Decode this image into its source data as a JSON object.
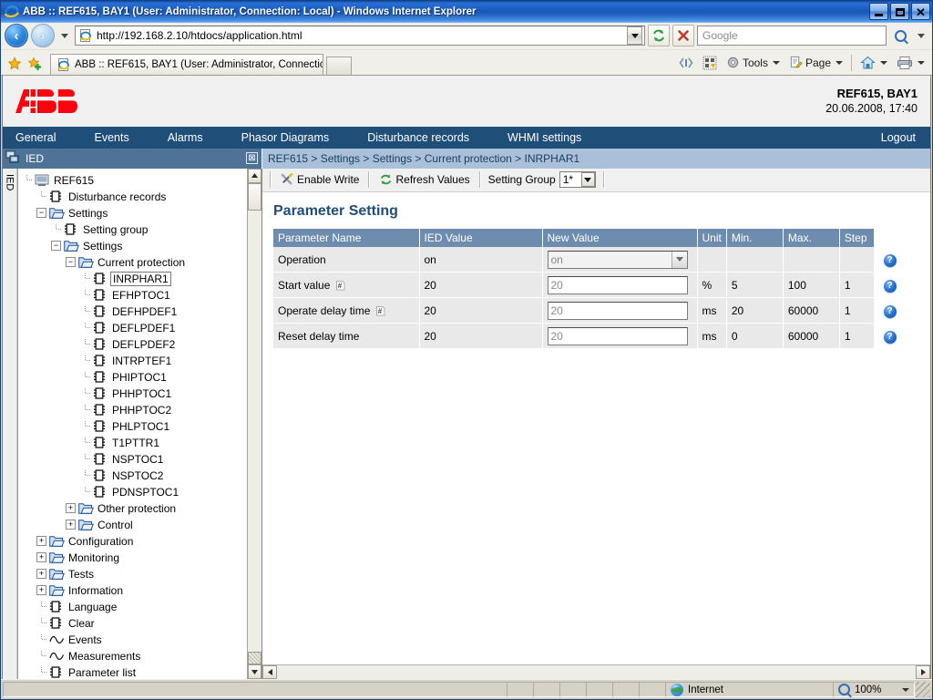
{
  "window": {
    "title": "ABB :: REF615, BAY1 (User: Administrator, Connection: Local) - Windows Internet Explorer",
    "minimize_label": "_",
    "maximize_label": "□",
    "close_label": "✕"
  },
  "browser": {
    "url": "http://192.168.2.10/htdocs/application.html",
    "search_placeholder": "Google",
    "tab_title": "ABB :: REF615, BAY1 (User: Administrator, Connectio...",
    "commands": [
      {
        "name": "tools",
        "label": "Tools",
        "has_caret": true
      },
      {
        "name": "page",
        "label": "Page",
        "has_caret": true
      }
    ]
  },
  "header": {
    "brand": "ABB",
    "device_name": "REF615, BAY1",
    "device_datetime": "20.06.2008, 17:40"
  },
  "nav": {
    "items": [
      {
        "id": "general",
        "label": "General"
      },
      {
        "id": "events",
        "label": "Events"
      },
      {
        "id": "alarms",
        "label": "Alarms"
      },
      {
        "id": "phasor-diagrams",
        "label": "Phasor Diagrams"
      },
      {
        "id": "disturbance-records",
        "label": "Disturbance records"
      },
      {
        "id": "whmi-settings",
        "label": "WHMI settings"
      }
    ],
    "logout": "Logout"
  },
  "panel": {
    "ied_label": "IED",
    "ied_tab_label": "IED",
    "close_glyph": "⊠",
    "breadcrumb": "REF615 > Settings > Settings > Current protection > INRPHAR1"
  },
  "tree": [
    {
      "label": "REF615",
      "depth": 0,
      "icon": "device-icon",
      "expander": "none",
      "selected": false
    },
    {
      "label": "Disturbance records",
      "depth": 1,
      "icon": "ied-leaf-icon",
      "expander": "none",
      "selected": false
    },
    {
      "label": "Settings",
      "depth": 1,
      "icon": "folder-icon",
      "expander": "collapse",
      "selected": false
    },
    {
      "label": "Setting group",
      "depth": 2,
      "icon": "ied-leaf-icon",
      "expander": "none",
      "selected": false
    },
    {
      "label": "Settings",
      "depth": 2,
      "icon": "folder-icon",
      "expander": "collapse",
      "selected": false
    },
    {
      "label": "Current protection",
      "depth": 3,
      "icon": "folder-icon",
      "expander": "collapse",
      "selected": false
    },
    {
      "label": "INRPHAR1",
      "depth": 4,
      "icon": "ied-leaf-icon",
      "expander": "none",
      "selected": true
    },
    {
      "label": "EFHPTOC1",
      "depth": 4,
      "icon": "ied-leaf-icon",
      "expander": "none",
      "selected": false
    },
    {
      "label": "DEFHPDEF1",
      "depth": 4,
      "icon": "ied-leaf-icon",
      "expander": "none",
      "selected": false
    },
    {
      "label": "DEFLPDEF1",
      "depth": 4,
      "icon": "ied-leaf-icon",
      "expander": "none",
      "selected": false
    },
    {
      "label": "DEFLPDEF2",
      "depth": 4,
      "icon": "ied-leaf-icon",
      "expander": "none",
      "selected": false
    },
    {
      "label": "INTRPTEF1",
      "depth": 4,
      "icon": "ied-leaf-icon",
      "expander": "none",
      "selected": false
    },
    {
      "label": "PHIPTOC1",
      "depth": 4,
      "icon": "ied-leaf-icon",
      "expander": "none",
      "selected": false
    },
    {
      "label": "PHHPTOC1",
      "depth": 4,
      "icon": "ied-leaf-icon",
      "expander": "none",
      "selected": false
    },
    {
      "label": "PHHPTOC2",
      "depth": 4,
      "icon": "ied-leaf-icon",
      "expander": "none",
      "selected": false
    },
    {
      "label": "PHLPTOC1",
      "depth": 4,
      "icon": "ied-leaf-icon",
      "expander": "none",
      "selected": false
    },
    {
      "label": "T1PTTR1",
      "depth": 4,
      "icon": "ied-leaf-icon",
      "expander": "none",
      "selected": false
    },
    {
      "label": "NSPTOC1",
      "depth": 4,
      "icon": "ied-leaf-icon",
      "expander": "none",
      "selected": false
    },
    {
      "label": "NSPTOC2",
      "depth": 4,
      "icon": "ied-leaf-icon",
      "expander": "none",
      "selected": false
    },
    {
      "label": "PDNSPTOC1",
      "depth": 4,
      "icon": "ied-leaf-icon",
      "expander": "none",
      "selected": false
    },
    {
      "label": "Other protection",
      "depth": 3,
      "icon": "folder-icon",
      "expander": "expand",
      "selected": false
    },
    {
      "label": "Control",
      "depth": 3,
      "icon": "folder-icon",
      "expander": "expand",
      "selected": false
    },
    {
      "label": "Configuration",
      "depth": 1,
      "icon": "folder-icon",
      "expander": "expand",
      "selected": false
    },
    {
      "label": "Monitoring",
      "depth": 1,
      "icon": "folder-icon",
      "expander": "expand",
      "selected": false
    },
    {
      "label": "Tests",
      "depth": 1,
      "icon": "folder-icon",
      "expander": "expand",
      "selected": false
    },
    {
      "label": "Information",
      "depth": 1,
      "icon": "folder-icon",
      "expander": "expand",
      "selected": false
    },
    {
      "label": "Language",
      "depth": 1,
      "icon": "ied-leaf-icon",
      "expander": "none",
      "selected": false
    },
    {
      "label": "Clear",
      "depth": 1,
      "icon": "ied-leaf-icon",
      "expander": "none",
      "selected": false
    },
    {
      "label": "Events",
      "depth": 1,
      "icon": "wave-icon",
      "expander": "none",
      "selected": false
    },
    {
      "label": "Measurements",
      "depth": 1,
      "icon": "wave-icon",
      "expander": "none",
      "selected": false
    },
    {
      "label": "Parameter list",
      "depth": 1,
      "icon": "ied-leaf-icon",
      "expander": "none",
      "selected": false
    }
  ],
  "toolbar": {
    "enable_write": "Enable Write",
    "refresh_values": "Refresh Values",
    "setting_group_label": "Setting Group",
    "setting_group_value": "1*"
  },
  "main": {
    "page_title": "Parameter Setting",
    "table": {
      "columns": [
        "Parameter Name",
        "IED Value",
        "New Value",
        "Unit",
        "Min.",
        "Max.",
        "Step"
      ],
      "rows": [
        {
          "name": "Operation",
          "modified_marker": false,
          "ied_value": "on",
          "new_value": "on",
          "control": "select",
          "unit": "",
          "min": "",
          "max": "",
          "step": "",
          "help": "?"
        },
        {
          "name": "Start value",
          "modified_marker": true,
          "ied_value": "20",
          "new_value": "20",
          "control": "input",
          "unit": "%",
          "min": "5",
          "max": "100",
          "step": "1",
          "help": "?"
        },
        {
          "name": "Operate delay time",
          "modified_marker": true,
          "ied_value": "20",
          "new_value": "20",
          "control": "input",
          "unit": "ms",
          "min": "20",
          "max": "60000",
          "step": "1",
          "help": "?"
        },
        {
          "name": "Reset delay time",
          "modified_marker": false,
          "ied_value": "20",
          "new_value": "20",
          "control": "input",
          "unit": "ms",
          "min": "0",
          "max": "60000",
          "step": "1",
          "help": "?"
        }
      ]
    }
  },
  "status": {
    "zone": "Internet",
    "zoom": "100%"
  },
  "colors": {
    "abb_red": "#ff000f",
    "nav_blue": "#1f4e79",
    "crumb_blue": "#a9c0d8",
    "table_header": "#6e8cad",
    "title_text": "#1f4e79"
  }
}
